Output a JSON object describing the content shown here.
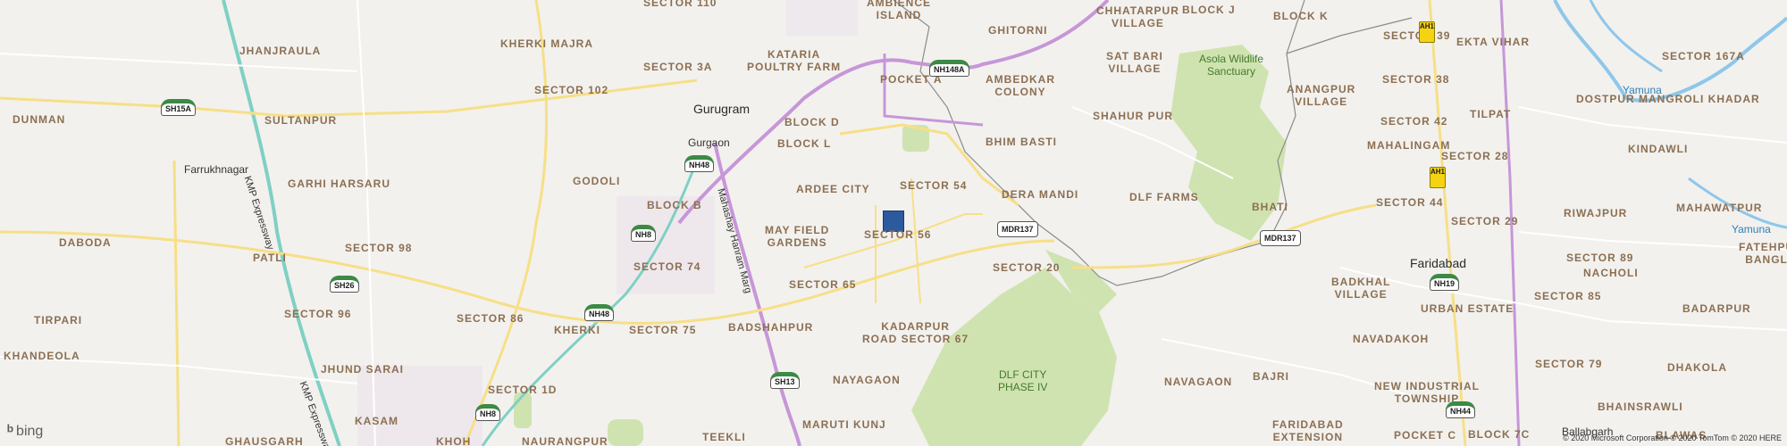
{
  "map": {
    "marker_color": "#2c5a9f",
    "colors": {
      "land": "#f2f1ee",
      "green": "#cfe3b0",
      "road_major": "#f7df86",
      "road_purple": "#c796d8",
      "expressway": "#7fd0c4",
      "water": "#8ec7ea",
      "urban": "#e9e5ea"
    },
    "cities": [
      {
        "name": "Gurugram"
      },
      {
        "name": "Gurgaon"
      },
      {
        "name": "Farrukhnagar"
      },
      {
        "name": "Faridabad"
      },
      {
        "name": "Ballabgarh"
      }
    ],
    "localities": [
      "SECTOR 110",
      "AMBIENCE\nISLAND",
      "GHITORNI",
      "CHHATARPUR\nVILLAGE",
      "BLOCK J",
      "BLOCK K",
      "JHANJRAULA",
      "KHERKI MAJRA",
      "KATARIA\nPOULTRY FARM",
      "SECTOR 3A",
      "POCKET A",
      "AMBEDKAR\nCOLONY",
      "SAT BARI\nVILLAGE",
      "SECTOR 39",
      "EKTA VIHAR",
      "SECTOR 167A",
      "SECTOR 102",
      "DUNMAN",
      "SULTANPUR",
      "BLOCK D",
      "SHAHUR PUR",
      "ANANGPUR\nVILLAGE",
      "SECTOR 38",
      "TILPAT",
      "DOSTPUR MANGROLI KHADAR",
      "BLOCK L",
      "BHIM BASTI",
      "SECTOR 42",
      "MAHALINGAM",
      "KINDAWLI",
      "SECTOR 28",
      "GODOLI",
      "GARHI HARSARU",
      "ARDEE CITY",
      "SECTOR 54",
      "DERA MANDI",
      "DLF FARMS",
      "BHATI",
      "SECTOR 44",
      "SECTOR 29",
      "RIWAJPUR",
      "MAHAWATPUR",
      "BLOCK B",
      "DABODA",
      "MAY FIELD\nGARDENS",
      "SECTOR 56",
      "SECTOR 98",
      "PATLI",
      "SECTOR 74",
      "SECTOR 20",
      "BADKHAL\nVILLAGE",
      "SECTOR 89",
      "NACHOLI",
      "SECTOR 65",
      "URBAN ESTATE",
      "SECTOR 85",
      "SECTOR 96",
      "TIRPARI",
      "SECTOR 86",
      "KHERKI",
      "SECTOR 75",
      "BADSHAHPUR",
      "KADARPUR\nROAD SECTOR 67",
      "BADARPUR",
      "NAVADAKOH",
      "KHANDEOLA",
      "DHAKOLA",
      "JHUND SARAI",
      "SECTOR 1D",
      "NAYAGAON",
      "NAVAGAON",
      "BAJRI",
      "NEW INDUSTRIAL\nTOWNSHIP",
      "SECTOR 79",
      "BHAINSRAWLI",
      "KASAM",
      "GHAUSGARH",
      "KHOH",
      "NAURANGPUR",
      "MARUTI KUNJ",
      "TEEKLI",
      "FARIDABAD\nEXTENSION",
      "POCKET C",
      "BLOCK 7C",
      "BLAWAS",
      "FATEHPUR\nBANGLA"
    ],
    "green_areas": [
      {
        "name": "Asola Wildlife\nSanctuary"
      },
      {
        "name": "DLF CITY\nPHASE IV"
      }
    ],
    "water_labels": [
      "Yamuna",
      "Yamuna"
    ],
    "road_names": [
      "KMP Expressway",
      "Mahashay Hanram Marg",
      "KMP Expressway"
    ],
    "shields": [
      {
        "label": "SH15A",
        "type": "nh"
      },
      {
        "label": "NH48",
        "type": "nh"
      },
      {
        "label": "NH148A",
        "type": "nh"
      },
      {
        "label": "NH8",
        "type": "nh"
      },
      {
        "label": "SH26",
        "type": "nh"
      },
      {
        "label": "NH48",
        "type": "nh"
      },
      {
        "label": "SH13",
        "type": "nh"
      },
      {
        "label": "NH8",
        "type": "nh"
      },
      {
        "label": "MDR137",
        "type": "plain"
      },
      {
        "label": "MDR137",
        "type": "plain"
      },
      {
        "label": "NH19",
        "type": "nh"
      },
      {
        "label": "NH44",
        "type": "nh"
      },
      {
        "label": "AH1",
        "type": "ah"
      },
      {
        "label": "AH1",
        "type": "ah"
      }
    ],
    "logo": "bing",
    "copyright": "© 2020 Microsoft Corporation © 2020 TomTom © 2020 HERE"
  }
}
